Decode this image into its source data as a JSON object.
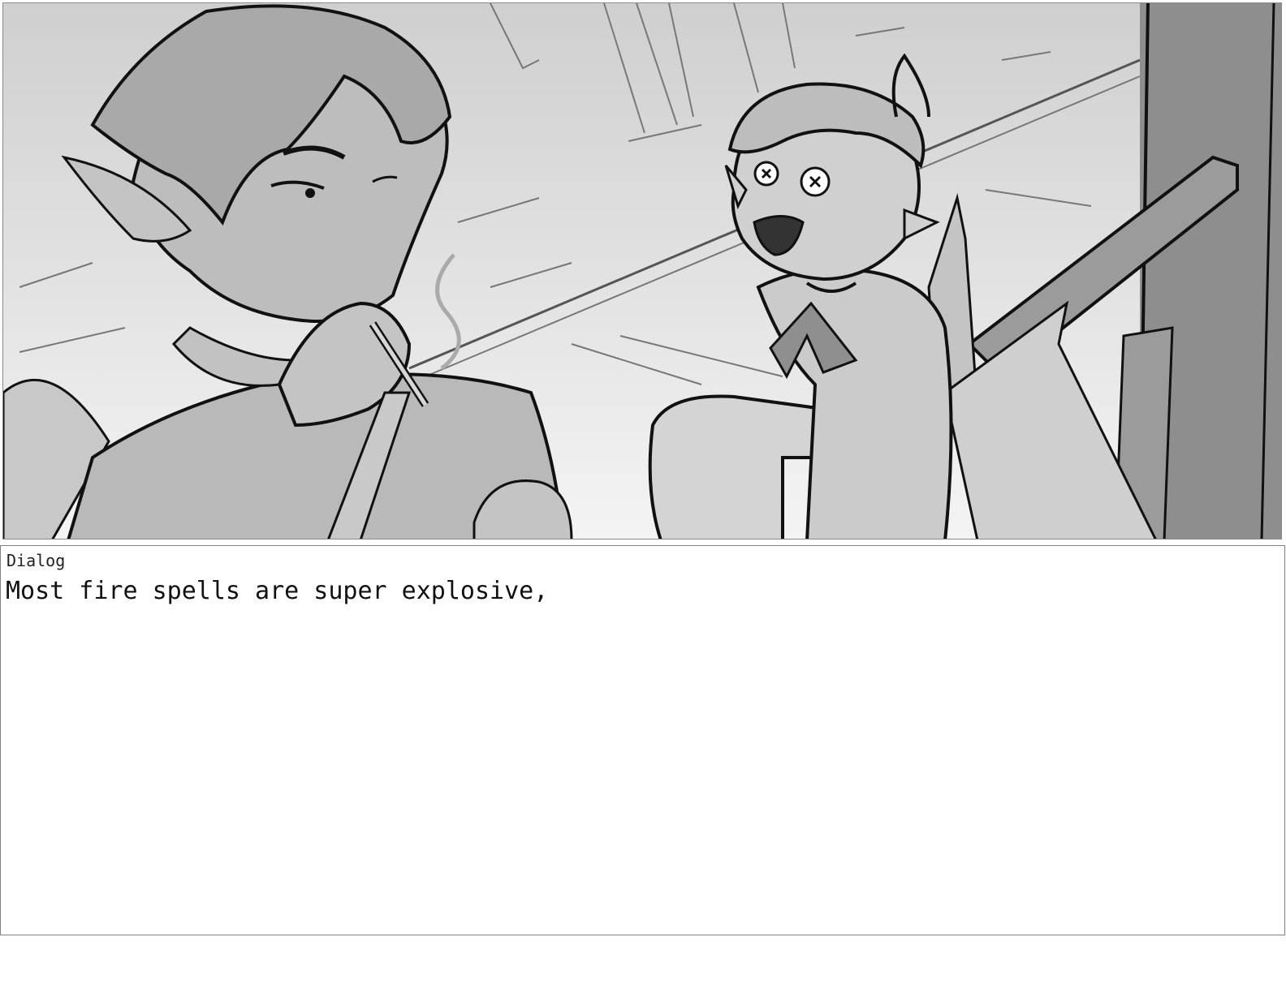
{
  "storyboard": {
    "frame": {
      "description_icon": "sketch-illustration",
      "background_color": "#e0e0e0",
      "line_color": "#111111"
    },
    "dialog": {
      "label": "Dialog",
      "text": "Most fire spells are super explosive,"
    }
  }
}
